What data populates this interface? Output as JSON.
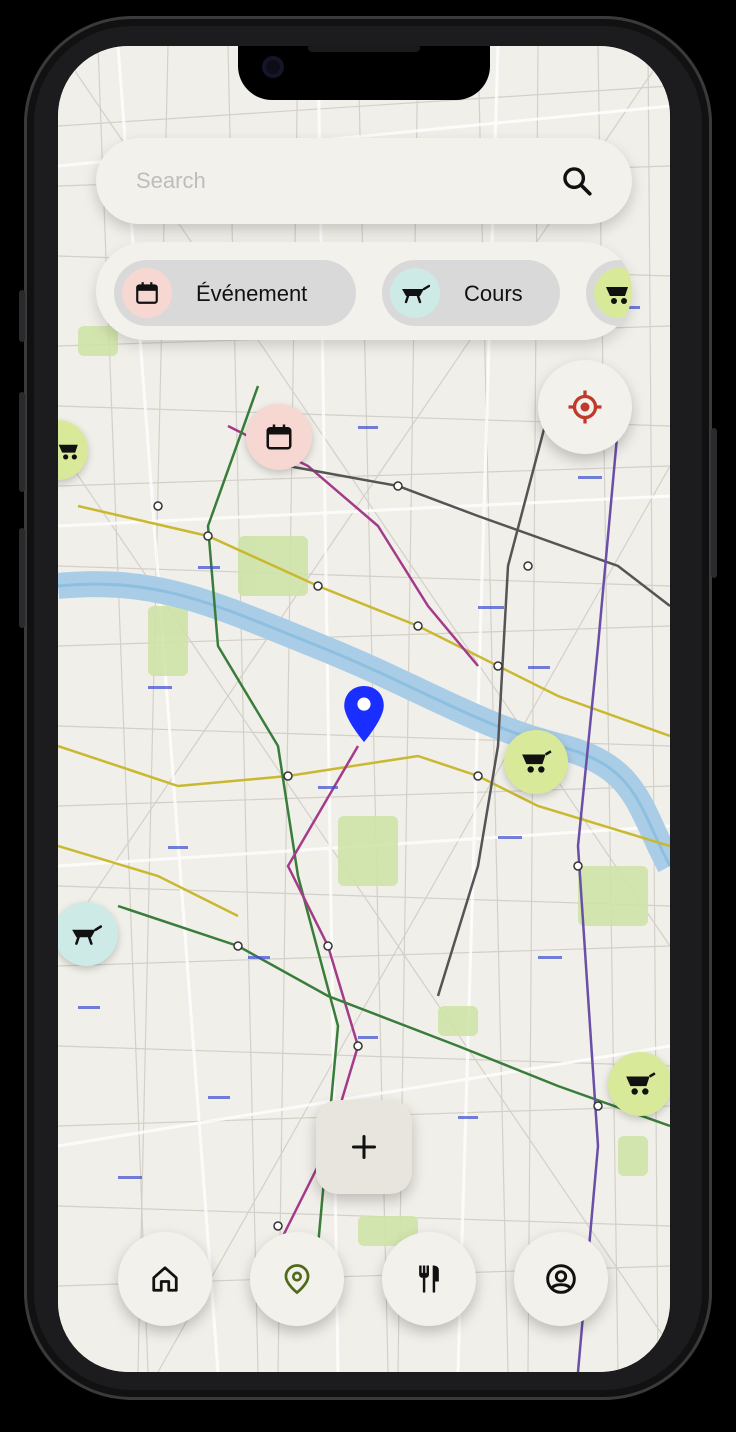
{
  "search": {
    "placeholder": "Search"
  },
  "filters": [
    {
      "label": "Événement",
      "icon": "calendar-icon",
      "color": "#f7d7d2"
    },
    {
      "label": "Cours",
      "icon": "wheelbarrow-icon",
      "color": "#cdeae6"
    },
    {
      "label": "",
      "icon": "wheelbarrow-icon",
      "color": "#d8ea9a"
    }
  ],
  "map_markers": [
    {
      "kind": "event",
      "icon": "calendar-icon",
      "color": "#f7d7d2"
    },
    {
      "kind": "shop",
      "icon": "wheelbarrow-icon",
      "color": "#d8ea9a"
    },
    {
      "kind": "course",
      "icon": "wheelbarrow-icon",
      "color": "#cdeae6"
    },
    {
      "kind": "shop",
      "icon": "wheelbarrow-icon",
      "color": "#d8ea9a"
    },
    {
      "kind": "shop",
      "icon": "wheelbarrow-icon",
      "color": "#d8ea9a"
    }
  ],
  "user_location_color": "#1a2fff",
  "locate_color": "#c0392b",
  "nav": [
    {
      "icon": "home-icon"
    },
    {
      "icon": "map-pin-icon",
      "active": true,
      "color": "#4f6b1a"
    },
    {
      "icon": "fork-knife-icon"
    },
    {
      "icon": "profile-icon"
    }
  ],
  "fab": {
    "icon": "plus-icon"
  }
}
